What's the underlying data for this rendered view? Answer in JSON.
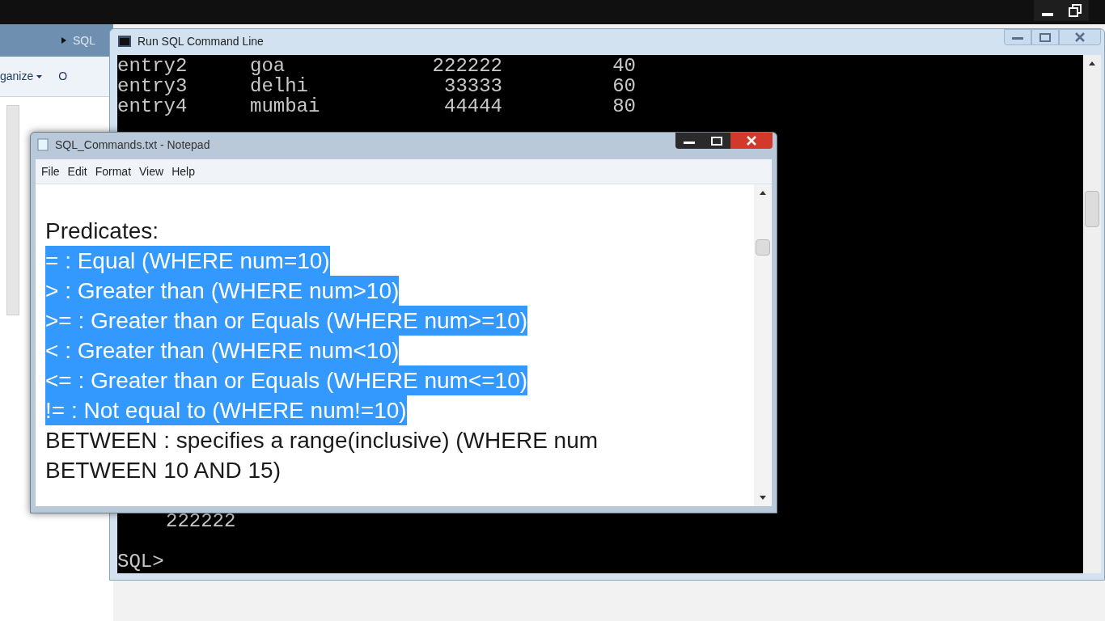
{
  "explorer": {
    "breadcrumb": "SQL",
    "toolbar": [
      {
        "label": "ganize",
        "dropdown": true
      },
      {
        "label": "O",
        "dropdown": false
      }
    ]
  },
  "console": {
    "title": "Run SQL Command Line",
    "rows": [
      {
        "cells": [
          "entry2",
          "goa",
          "222222",
          "40"
        ]
      },
      {
        "cells": [
          "entry3",
          "delhi",
          "33333",
          "60"
        ]
      },
      {
        "cells": [
          "entry4",
          "mumbai",
          "44444",
          "80"
        ]
      }
    ],
    "output_lines": [
      "222222"
    ],
    "prompt": "SQL>"
  },
  "notepad": {
    "title": "SQL_Commands.txt - Notepad",
    "menu": [
      "File",
      "Edit",
      "Format",
      "View",
      "Help"
    ],
    "lines": [
      {
        "text": "Predicates:",
        "selected": false
      },
      {
        "text": "= : Equal (WHERE num=10)",
        "selected": true
      },
      {
        "text": "> : Greater than (WHERE num>10)",
        "selected": true
      },
      {
        "text": ">= : Greater than or Equals (WHERE num>=10)",
        "selected": true
      },
      {
        "text": "< : Greater than (WHERE num<10)",
        "selected": true
      },
      {
        "text": "<= : Greater than or Equals (WHERE num<=10)",
        "selected": true
      },
      {
        "text": "!= : Not equal to (WHERE num!=10)",
        "selected": true
      },
      {
        "text": "BETWEEN : specifies a range(inclusive) (WHERE num BETWEEN 10 AND 15)",
        "selected": false
      }
    ]
  }
}
